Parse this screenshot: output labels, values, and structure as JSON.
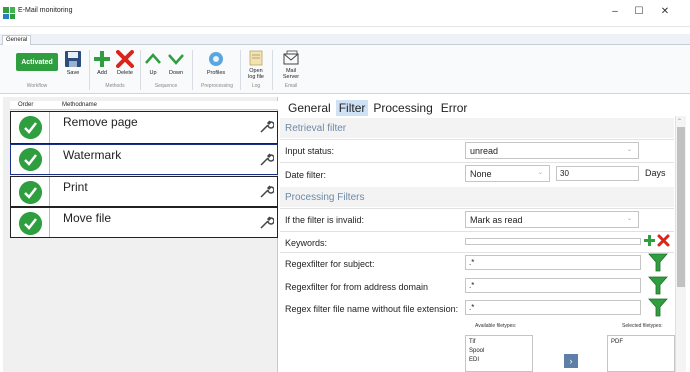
{
  "window": {
    "title": "E-Mail monitoring",
    "minimize": "–",
    "maximize": "☐",
    "close": "✕"
  },
  "ribbon": {
    "tab": "General",
    "activated": "Activated",
    "save": "Save",
    "add": "Add",
    "delete": "Delete",
    "up": "Up",
    "down": "Down",
    "profiles": "Profiles",
    "open_log_1": "Open",
    "open_log_2": "log file",
    "mail_server_1": "Mail",
    "mail_server_2": "Server",
    "groups": {
      "workflow": "Workflow",
      "methods": "Methods",
      "sequence": "Sequence",
      "preprocessing": "Preprocessing",
      "log": "Log",
      "email": "Email"
    }
  },
  "methods": {
    "header_order": "Order",
    "header_name": "Methodname",
    "rows": [
      {
        "name": "Remove page"
      },
      {
        "name": "Watermark"
      },
      {
        "name": "Print"
      },
      {
        "name": "Move file"
      }
    ]
  },
  "tabs": [
    "General",
    "Filter",
    "Processing",
    "Error"
  ],
  "active_tab": "Filter",
  "filter": {
    "retrieval_title": "Retrieval filter",
    "input_status_label": "Input status:",
    "input_status_value": "unread",
    "date_filter_label": "Date filter:",
    "date_filter_value": "None",
    "date_filter_number": "30",
    "days": "Days",
    "processing_title": "Processing Filters",
    "invalid_label": "If the filter is invalid:",
    "invalid_value": "Mark as read",
    "keywords_label": "Keywords:",
    "subject_label": "Regexfilter for subject:",
    "subject_value": ".*",
    "domain_label": "Regexfilter for from address domain",
    "domain_value": ".*",
    "filename_label": "Regex filter file name without file extension:",
    "filename_value": ".*",
    "available_label": "Available filetypes:",
    "selected_label": "Selected filetypes:",
    "available_types": [
      "Tif",
      "Spool",
      "EDI"
    ],
    "selected_types": [
      "PDF"
    ],
    "move_right": "›"
  },
  "colors": {
    "accent_green": "#2e9e3f",
    "delete_red": "#d9261c",
    "tab_active": "#cfe1f5",
    "section_text": "#6d8aa8"
  }
}
